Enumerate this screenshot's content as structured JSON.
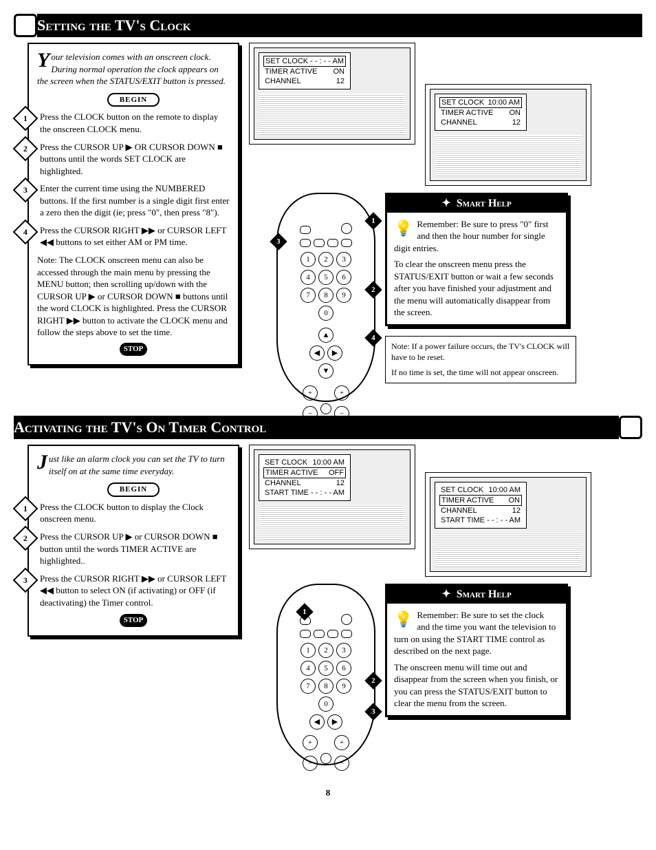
{
  "page_number": "8",
  "section1": {
    "title": "Setting the TV's Clock",
    "intro_dropcap": "Y",
    "intro_rest": "our television comes with an onscreen clock. During normal operation the clock appears on the screen when the STATUS/EXIT button is pressed.",
    "begin": "BEGIN",
    "stop": "STOP",
    "step1": "Press the CLOCK button on the remote to display the onscreen CLOCK menu.",
    "step2": "Press the CURSOR UP ▶ OR CURSOR DOWN ■ buttons until the words SET CLOCK are highlighted.",
    "step3": "Enter the current time using the NUMBERED buttons. If the first number is a single digit first enter a zero then the digit (ie; press \"0\", then press \"8\").",
    "step4": "Press the CURSOR RIGHT ▶▶ or CURSOR LEFT ◀◀ buttons to set either AM or PM time.",
    "note": "Note: The CLOCK onscreen menu can also be accessed through the main menu by pressing the MENU button; then scrolling up/down with the CURSOR UP ▶ or CURSOR DOWN ■ buttons until the word CLOCK is highlighted. Press the CURSOR RIGHT ▶▶ button to activate the CLOCK menu and follow the steps above to set the time.",
    "menuA": {
      "r1l": "SET CLOCK",
      "r1r": "- - : - -  AM",
      "r2l": "TIMER ACTIVE",
      "r2r": "ON",
      "r3l": "CHANNEL",
      "r3r": "12"
    },
    "menuB": {
      "r1l": "SET CLOCK",
      "r1r": "10:00  AM",
      "r2l": "TIMER ACTIVE",
      "r2r": "ON",
      "r3l": "CHANNEL",
      "r3r": "12"
    },
    "smart_title": "Smart Help",
    "smart_p1": "Remember: Be sure to press \"0\" first and then the hour number for single digit entries.",
    "smart_p2": "To clear the onscreen menu press the STATUS/EXIT button or wait a few seconds after you have finished your adjustment and the menu will automatically disappear from the screen.",
    "note_p1": "Note: If a power failure occurs, the TV's CLOCK will have to be reset.",
    "note_p2": "If no time is set, the time will not appear onscreen."
  },
  "section2": {
    "title": "Activating the TV's On Timer Control",
    "intro_dropcap": "J",
    "intro_rest": "ust like an alarm clock you can set the TV to turn itself on at the same time everyday.",
    "begin": "BEGIN",
    "stop": "STOP",
    "step1": "Press the CLOCK button to display the Clock onscreen menu.",
    "step2": "Press the CURSOR UP ▶ or CURSOR DOWN ■ button until the words TIMER ACTIVE are highlighted..",
    "step3": "Press the CURSOR RIGHT ▶▶ or CURSOR LEFT ◀◀ button to select ON (if activating) or OFF (if deactivating) the Timer control.",
    "menuA": {
      "r1l": "SET CLOCK",
      "r1r": "10:00  AM",
      "r2l": "TIMER ACTIVE",
      "r2r": "OFF",
      "r3l": "CHANNEL",
      "r3r": "12",
      "r4l": "START TIME",
      "r4r": "- - : - - AM"
    },
    "menuB": {
      "r1l": "SET CLOCK",
      "r1r": "10:00  AM",
      "r2l": "TIMER ACTIVE",
      "r2r": "ON",
      "r3l": "CHANNEL",
      "r3r": "12",
      "r4l": "START TIME",
      "r4r": "- - : - - AM"
    },
    "smart_title": "Smart Help",
    "smart_p1": "Remember: Be sure to set the clock and the time you want the television to turn on using the START TIME control as described on the next page.",
    "smart_p2": "The onscreen menu will time out and disappear from the screen when you finish, or you can press the STATUS/EXIT button to clear the menu from the screen."
  }
}
